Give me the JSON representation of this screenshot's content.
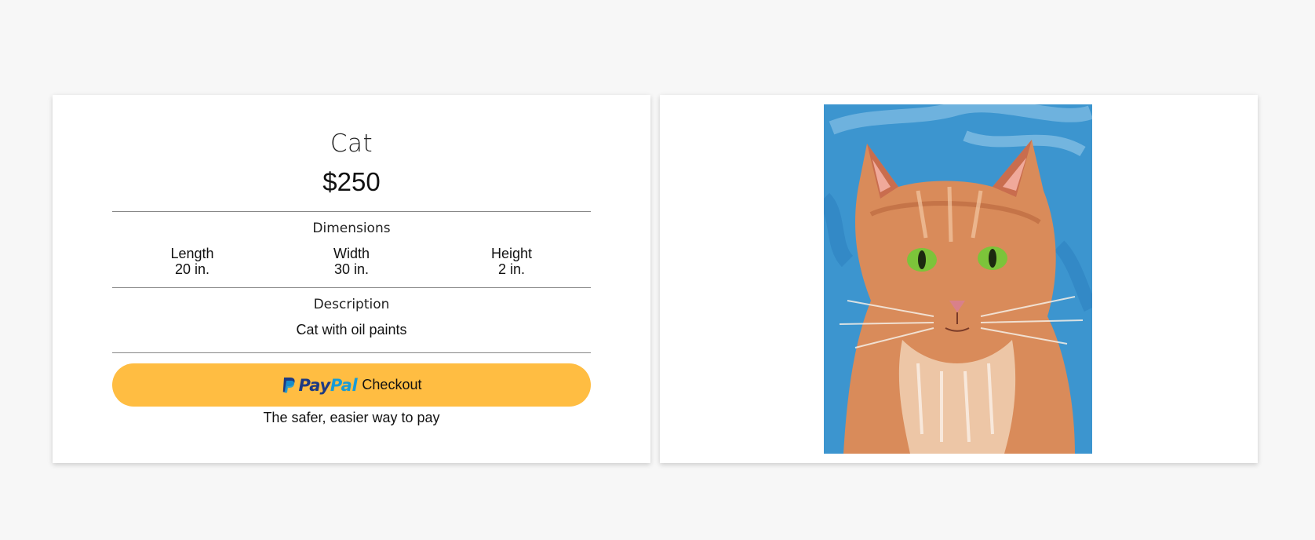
{
  "product": {
    "title": "Cat",
    "price": "$250"
  },
  "dimensions": {
    "heading": "Dimensions",
    "items": [
      {
        "label": "Length",
        "value": "20 in."
      },
      {
        "label": "Width",
        "value": "30 in."
      },
      {
        "label": "Height",
        "value": "2 in."
      }
    ]
  },
  "description": {
    "heading": "Description",
    "text": "Cat with oil paints"
  },
  "checkout": {
    "brand_pay": "Pay",
    "brand_pal": "Pal",
    "button_label": "Checkout",
    "tagline": "The safer, easier way to pay",
    "button_color": "#ffbd42",
    "brand_dark": "#1d3a82",
    "brand_light": "#179bd7"
  },
  "artwork": {
    "alt": "Cat",
    "background_color": "#3c95cf",
    "fur_color": "#d98b5a",
    "eye_color": "#7cc43a"
  }
}
